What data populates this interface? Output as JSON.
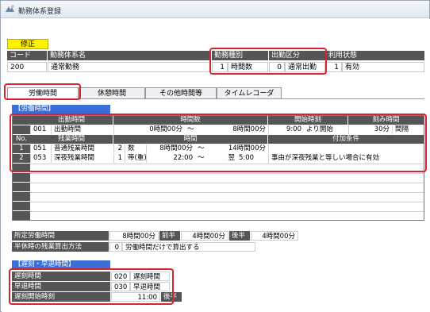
{
  "window": {
    "title": "勤務体系登録"
  },
  "header": {
    "edit_badge": "修正",
    "columns": {
      "code": "コード",
      "name": "勤務体系名",
      "work_type": "勤務種別",
      "attendance_type": "出勤区分",
      "usage_status": "利用状態"
    },
    "values": {
      "code": "200",
      "name": "通常勤務",
      "work_type_num": "1",
      "work_type_text": "時間数",
      "attendance_num": "0",
      "attendance_text": "通常出勤",
      "usage_num": "1",
      "usage_text": "有効"
    }
  },
  "tabs": [
    {
      "label": "労働時間"
    },
    {
      "label": "休憩時間"
    },
    {
      "label": "その他時間等"
    },
    {
      "label": "タイムレコーダ"
    }
  ],
  "work_section": {
    "title": "【労働時間】",
    "row1_headers": {
      "attendance_time": "出勤時間",
      "hours": "時間数",
      "start_time": "開始時刻",
      "rounding": "刻み時間"
    },
    "attendance": {
      "code": "001",
      "name": "出勤時間",
      "from": "0時間00分",
      "tilde": "〜",
      "to": "8時間00分",
      "start": "9:00",
      "start_suffix": "より開始",
      "round_value": "30分",
      "round_text": "間隔"
    },
    "row2_headers": {
      "no": "No.",
      "overtime": "残業時間",
      "time": "時間",
      "condition": "付加条件"
    },
    "overtime_rows": [
      {
        "no": "1",
        "code": "051",
        "name": "普通残業時間",
        "kind_num": "2",
        "kind_text": "数",
        "from": "8時間00分",
        "tilde": "〜",
        "to": "14時間00分",
        "condition": ""
      },
      {
        "no": "2",
        "code": "053",
        "name": "深夜残業時間",
        "kind_num": "1",
        "kind_text": "帯(重)",
        "from": "22:00",
        "tilde": "〜",
        "to_prefix": "翌",
        "to": "5:00",
        "condition": "事由が深夜残業と等しい場合に有効"
      }
    ]
  },
  "prescribed": {
    "label": "所定労働時間",
    "value1": "8時間00分",
    "first_half_label": "前半",
    "value2": "4時間00分",
    "second_half_label": "後半",
    "value3": "4時間00分"
  },
  "half_day": {
    "label": "半休時の残業算出方法",
    "num": "0",
    "text": "労働時間だけで算出する"
  },
  "late_section": {
    "title": "【遅刻・早退時間】",
    "rows": [
      {
        "label": "遅刻時間",
        "code": "020",
        "text": "遅刻時間"
      },
      {
        "label": "早退時間",
        "code": "030",
        "text": "早退時間"
      }
    ],
    "late_start": {
      "label": "遅刻開始時刻",
      "value": "11:00",
      "suffix_label": "後半"
    }
  }
}
